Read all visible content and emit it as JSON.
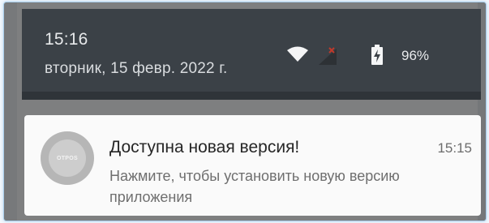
{
  "status": {
    "time": "15:16",
    "date": "вторник, 15 февр. 2022 г.",
    "battery_percent": "96%",
    "icons": [
      "wifi-icon",
      "signal-no-sim-icon",
      "battery-charging-icon"
    ]
  },
  "notification": {
    "app_icon_text": "OTPOS",
    "title": "Доступна новая версия!",
    "time": "15:15",
    "text": "Нажмите, чтобы установить новую версию приложения"
  },
  "colors": {
    "panel": "#3b4147",
    "card": "#fafafa",
    "scrim": "#7e7f80",
    "signal_x": "#c0392b"
  }
}
